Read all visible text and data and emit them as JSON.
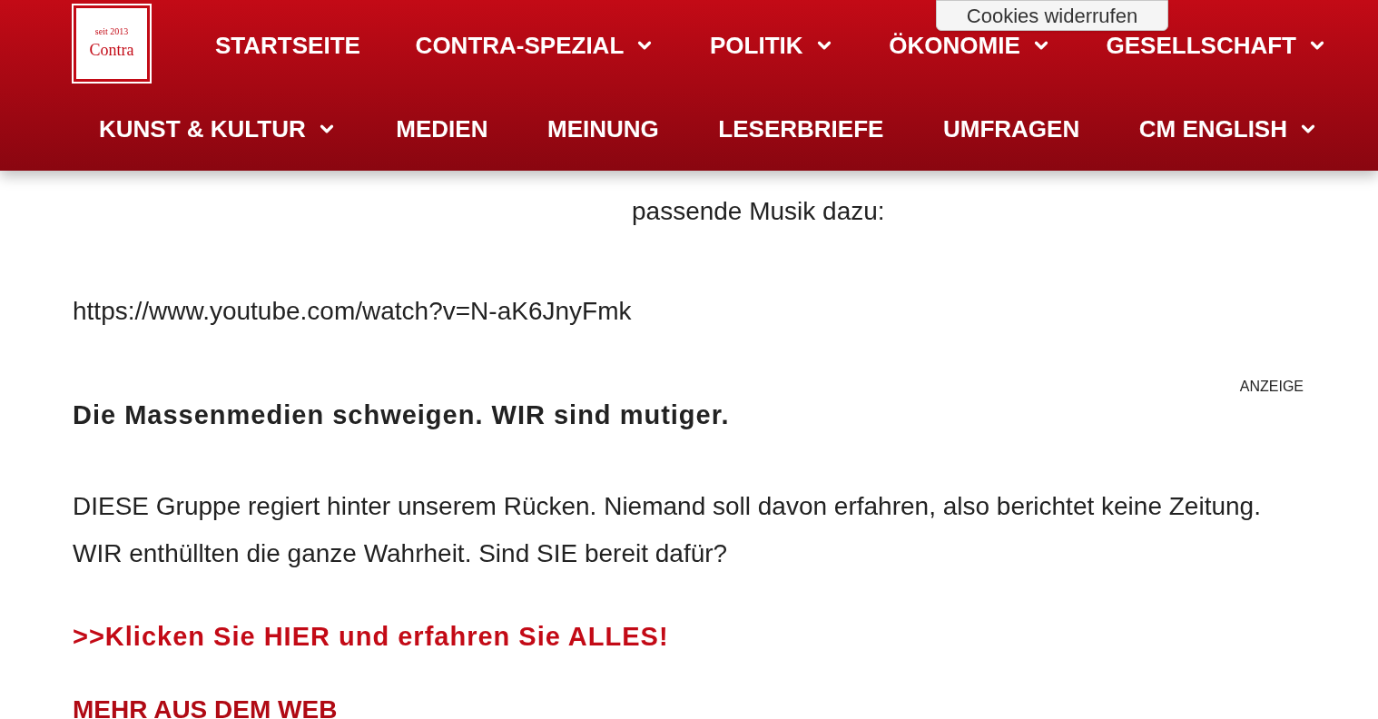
{
  "header": {
    "logo": {
      "tagline": "seit 2013",
      "name": "Contra"
    },
    "nav_rows": [
      [
        {
          "label": "STARTSEITE",
          "dropdown": false
        },
        {
          "label": "CONTRA-SPEZIAL",
          "dropdown": true
        },
        {
          "label": "POLITIK",
          "dropdown": true
        },
        {
          "label": "ÖKONOMIE",
          "dropdown": true
        },
        {
          "label": "GESELLSCHAFT",
          "dropdown": true
        }
      ],
      [
        {
          "label": "KUNST & KULTUR",
          "dropdown": true
        },
        {
          "label": "MEDIEN",
          "dropdown": false
        },
        {
          "label": "MEINUNG",
          "dropdown": false
        },
        {
          "label": "LESERBRIEFE",
          "dropdown": false
        },
        {
          "label": "UMFRAGEN",
          "dropdown": false
        },
        {
          "label": "CM ENGLISH",
          "dropdown": true
        }
      ]
    ]
  },
  "cookie_button": "Cookies widerrufen",
  "article": {
    "column_text": "passende Musik dazu:",
    "url": "https://www.youtube.com/watch?v=N-aK6JnyFmk"
  },
  "ad": {
    "label": "ANZEIGE",
    "headline": "Die Massenmedien schweigen. WIR sind mutiger.",
    "body": "DIESE Gruppe regiert hinter unserem Rücken. Niemand soll davon erfahren, also berichtet keine Zeitung. WIR enthüllten die ganze Wahrheit. Sind SIE bereit dafür?",
    "link": ">>Klicken Sie HIER und erfahren Sie ALLES!"
  },
  "section_heading": "MEHR AUS DEM WEB"
}
